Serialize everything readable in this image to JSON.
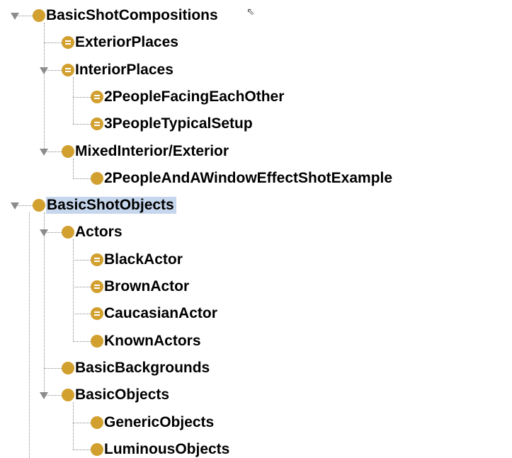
{
  "colors": {
    "class_icon": "#d2a02f",
    "selection": "#c6d6ec",
    "connector": "#8a8a8a",
    "toggle": "#8c8c8c"
  },
  "tree": [
    {
      "label": "BasicShotCompositions",
      "depth": 0,
      "expanded": true,
      "icon": "class-circle-icon"
    },
    {
      "label": "ExteriorPlaces",
      "depth": 1,
      "expanded": false,
      "icon": "defined-class-icon"
    },
    {
      "label": "InteriorPlaces",
      "depth": 1,
      "expanded": true,
      "icon": "defined-class-icon"
    },
    {
      "label": "2PeopleFacingEachOther",
      "depth": 2,
      "expanded": false,
      "icon": "defined-class-icon"
    },
    {
      "label": "3PeopleTypicalSetup",
      "depth": 2,
      "expanded": false,
      "icon": "defined-class-icon"
    },
    {
      "label": "MixedInterior/Exterior",
      "depth": 1,
      "expanded": true,
      "icon": "class-circle-icon"
    },
    {
      "label": "2PeopleAndAWindowEffectShotExample",
      "depth": 2,
      "expanded": false,
      "icon": "class-circle-icon"
    },
    {
      "label": "BasicShotObjects",
      "depth": 0,
      "expanded": true,
      "icon": "class-circle-icon",
      "selected": true
    },
    {
      "label": "Actors",
      "depth": 1,
      "expanded": true,
      "icon": "class-circle-icon"
    },
    {
      "label": "BlackActor",
      "depth": 2,
      "expanded": false,
      "icon": "defined-class-icon"
    },
    {
      "label": "BrownActor",
      "depth": 2,
      "expanded": false,
      "icon": "defined-class-icon"
    },
    {
      "label": "CaucasianActor",
      "depth": 2,
      "expanded": false,
      "icon": "defined-class-icon"
    },
    {
      "label": "KnownActors",
      "depth": 2,
      "expanded": false,
      "icon": "class-circle-icon"
    },
    {
      "label": "BasicBackgrounds",
      "depth": 1,
      "expanded": false,
      "icon": "class-circle-icon"
    },
    {
      "label": "BasicObjects",
      "depth": 1,
      "expanded": true,
      "icon": "class-circle-icon"
    },
    {
      "label": "GenericObjects",
      "depth": 2,
      "expanded": false,
      "icon": "class-circle-icon"
    },
    {
      "label": "LuminousObjects",
      "depth": 2,
      "expanded": false,
      "icon": "class-circle-icon"
    }
  ]
}
